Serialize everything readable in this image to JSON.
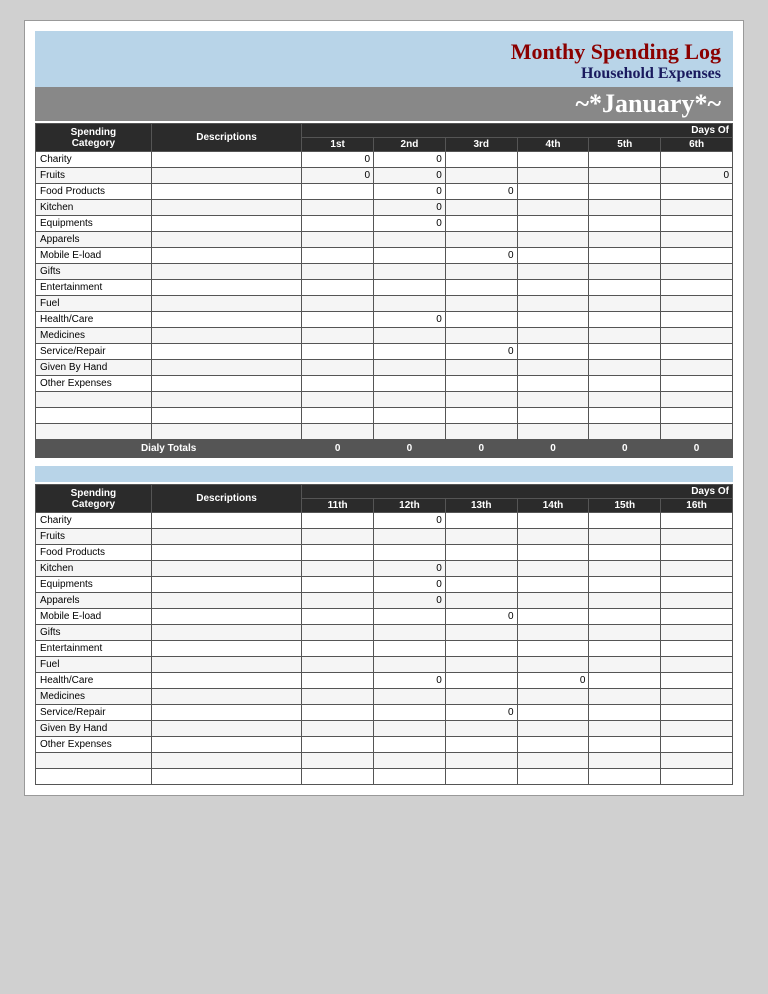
{
  "header": {
    "title_main": "Monthy Spending Log",
    "title_sub": "Household Expenses",
    "month": "~*January*~"
  },
  "section1": {
    "col_spending": "Spending",
    "col_category": "Category",
    "col_descriptions": "Descriptions",
    "days_of_label": "Days Of",
    "col_1st": "1st",
    "col_2nd": "2nd",
    "col_3rd": "3rd",
    "col_4th": "4th",
    "col_5th": "5th",
    "col_6th": "6th",
    "rows": [
      {
        "cat": "Charity",
        "desc": "",
        "c1": "0",
        "c2": "0",
        "c3": "",
        "c4": "",
        "c5": "",
        "c6": ""
      },
      {
        "cat": "Fruits",
        "desc": "",
        "c1": "0",
        "c2": "0",
        "c3": "",
        "c4": "",
        "c5": "",
        "c6": "0"
      },
      {
        "cat": "Food Products",
        "desc": "",
        "c1": "",
        "c2": "0",
        "c3": "0",
        "c4": "",
        "c5": "",
        "c6": ""
      },
      {
        "cat": "Kitchen",
        "desc": "",
        "c1": "",
        "c2": "0",
        "c3": "",
        "c4": "",
        "c5": "",
        "c6": ""
      },
      {
        "cat": "Equipments",
        "desc": "",
        "c1": "",
        "c2": "0",
        "c3": "",
        "c4": "",
        "c5": "",
        "c6": ""
      },
      {
        "cat": "Apparels",
        "desc": "",
        "c1": "",
        "c2": "",
        "c3": "",
        "c4": "",
        "c5": "",
        "c6": ""
      },
      {
        "cat": "Mobile E-load",
        "desc": "",
        "c1": "",
        "c2": "",
        "c3": "0",
        "c4": "",
        "c5": "",
        "c6": ""
      },
      {
        "cat": "Gifts",
        "desc": "",
        "c1": "",
        "c2": "",
        "c3": "",
        "c4": "",
        "c5": "",
        "c6": ""
      },
      {
        "cat": "Entertainment",
        "desc": "",
        "c1": "",
        "c2": "",
        "c3": "",
        "c4": "",
        "c5": "",
        "c6": ""
      },
      {
        "cat": "Fuel",
        "desc": "",
        "c1": "",
        "c2": "",
        "c3": "",
        "c4": "",
        "c5": "",
        "c6": ""
      },
      {
        "cat": "Health/Care",
        "desc": "",
        "c1": "",
        "c2": "0",
        "c3": "",
        "c4": "",
        "c5": "",
        "c6": ""
      },
      {
        "cat": "Medicines",
        "desc": "",
        "c1": "",
        "c2": "",
        "c3": "",
        "c4": "",
        "c5": "",
        "c6": ""
      },
      {
        "cat": "Service/Repair",
        "desc": "",
        "c1": "",
        "c2": "",
        "c3": "0",
        "c4": "",
        "c5": "",
        "c6": ""
      },
      {
        "cat": "Given By Hand",
        "desc": "",
        "c1": "",
        "c2": "",
        "c3": "",
        "c4": "",
        "c5": "",
        "c6": ""
      },
      {
        "cat": "Other Expenses",
        "desc": "",
        "c1": "",
        "c2": "",
        "c3": "",
        "c4": "",
        "c5": "",
        "c6": ""
      },
      {
        "cat": "",
        "desc": "",
        "c1": "",
        "c2": "",
        "c3": "",
        "c4": "",
        "c5": "",
        "c6": ""
      },
      {
        "cat": "",
        "desc": "",
        "c1": "",
        "c2": "",
        "c3": "",
        "c4": "",
        "c5": "",
        "c6": ""
      },
      {
        "cat": "",
        "desc": "",
        "c1": "",
        "c2": "",
        "c3": "",
        "c4": "",
        "c5": "",
        "c6": ""
      }
    ],
    "totals_label": "Dialy Totals",
    "totals": {
      "c1": "0",
      "c2": "0",
      "c3": "0",
      "c4": "0",
      "c5": "0",
      "c6": "0"
    }
  },
  "section2": {
    "col_spending": "Spending",
    "col_category": "Category",
    "col_descriptions": "Descriptions",
    "days_of_label": "Days Of",
    "col_11th": "11th",
    "col_12th": "12th",
    "col_13th": "13th",
    "col_14th": "14th",
    "col_15th": "15th",
    "col_16th": "16th",
    "rows": [
      {
        "cat": "Charity",
        "desc": "",
        "c1": "",
        "c2": "0",
        "c3": "",
        "c4": "",
        "c5": "",
        "c6": ""
      },
      {
        "cat": "Fruits",
        "desc": "",
        "c1": "",
        "c2": "",
        "c3": "",
        "c4": "",
        "c5": "",
        "c6": ""
      },
      {
        "cat": "Food Products",
        "desc": "",
        "c1": "",
        "c2": "",
        "c3": "",
        "c4": "",
        "c5": "",
        "c6": ""
      },
      {
        "cat": "Kitchen",
        "desc": "",
        "c1": "",
        "c2": "0",
        "c3": "",
        "c4": "",
        "c5": "",
        "c6": ""
      },
      {
        "cat": "Equipments",
        "desc": "",
        "c1": "",
        "c2": "0",
        "c3": "",
        "c4": "",
        "c5": "",
        "c6": ""
      },
      {
        "cat": "Apparels",
        "desc": "",
        "c1": "",
        "c2": "0",
        "c3": "",
        "c4": "",
        "c5": "",
        "c6": ""
      },
      {
        "cat": "Mobile E-load",
        "desc": "",
        "c1": "",
        "c2": "",
        "c3": "0",
        "c4": "",
        "c5": "",
        "c6": ""
      },
      {
        "cat": "Gifts",
        "desc": "",
        "c1": "",
        "c2": "",
        "c3": "",
        "c4": "",
        "c5": "",
        "c6": ""
      },
      {
        "cat": "Entertainment",
        "desc": "",
        "c1": "",
        "c2": "",
        "c3": "",
        "c4": "",
        "c5": "",
        "c6": ""
      },
      {
        "cat": "Fuel",
        "desc": "",
        "c1": "",
        "c2": "",
        "c3": "",
        "c4": "",
        "c5": "",
        "c6": ""
      },
      {
        "cat": "Health/Care",
        "desc": "",
        "c1": "",
        "c2": "0",
        "c3": "",
        "c4": "0",
        "c5": "",
        "c6": ""
      },
      {
        "cat": "Medicines",
        "desc": "",
        "c1": "",
        "c2": "",
        "c3": "",
        "c4": "",
        "c5": "",
        "c6": ""
      },
      {
        "cat": "Service/Repair",
        "desc": "",
        "c1": "",
        "c2": "",
        "c3": "0",
        "c4": "",
        "c5": "",
        "c6": ""
      },
      {
        "cat": "Given By Hand",
        "desc": "",
        "c1": "",
        "c2": "",
        "c3": "",
        "c4": "",
        "c5": "",
        "c6": ""
      },
      {
        "cat": "Other Expenses",
        "desc": "",
        "c1": "",
        "c2": "",
        "c3": "",
        "c4": "",
        "c5": "",
        "c6": ""
      },
      {
        "cat": "",
        "desc": "",
        "c1": "",
        "c2": "",
        "c3": "",
        "c4": "",
        "c5": "",
        "c6": ""
      },
      {
        "cat": "",
        "desc": "",
        "c1": "",
        "c2": "",
        "c3": "",
        "c4": "",
        "c5": "",
        "c6": ""
      }
    ]
  }
}
